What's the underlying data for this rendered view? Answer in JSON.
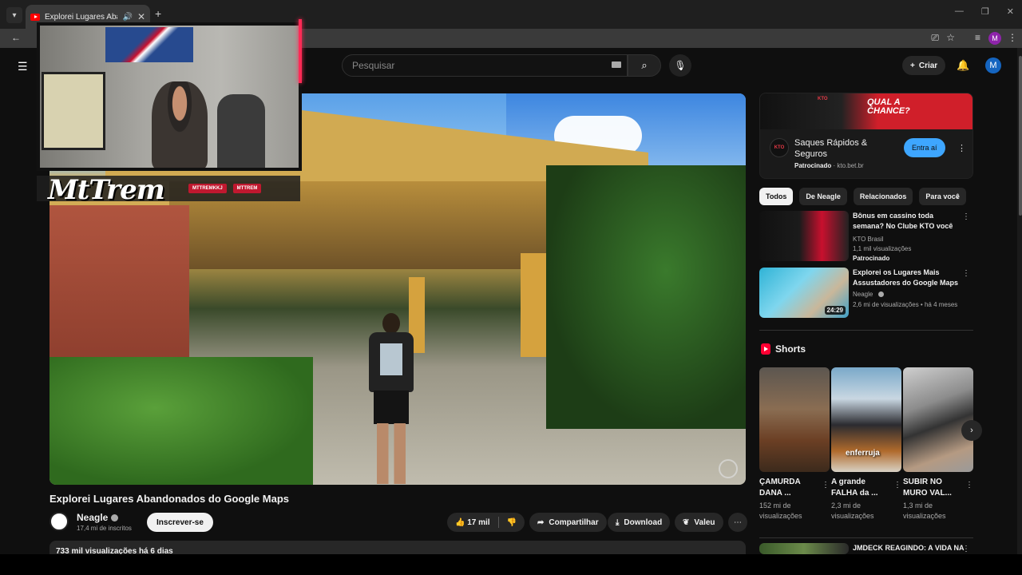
{
  "browser": {
    "tab_title": "Explorei Lugares Abandonados do Google Maps",
    "profile_initial": "M",
    "icons": {
      "tab_menu": "chevron-down-icon",
      "audio": "speaker-icon",
      "close": "close-icon",
      "new_tab": "plus-icon"
    }
  },
  "webcam": {
    "brand_logo": "MtTrem",
    "socials": [
      "MTTREMKKJ",
      "MTTREM"
    ]
  },
  "masthead": {
    "search_placeholder": "Pesquisar",
    "create_label": "Criar",
    "avatar_initial": "M"
  },
  "video": {
    "title": "Explorei Lugares Abandonados do Google Maps",
    "channel": {
      "name": "Neagle",
      "subscribers": "17,4 mi de inscritos",
      "subscribe_label": "Inscrever-se"
    },
    "actions": {
      "likes": "17 mil",
      "share": "Compartilhar",
      "download": "Download",
      "thanks": "Valeu"
    },
    "description_stats": "733 mil visualizações  há 6 dias"
  },
  "sidebar": {
    "ad": {
      "banner_brand": "KTO",
      "banner_text": "QUAL A CHANCE?",
      "logo_text": "KTO",
      "title": "Saques Rápidos & Seguros",
      "sponsored": "Patrocinado",
      "domain": "kto.bet.br",
      "cta": "Entra aí"
    },
    "chips": [
      "Todos",
      "De Neagle",
      "Relacionados",
      "Para você"
    ],
    "recommendations": [
      {
        "title": "Bônus em cassino toda semana? No Clube KTO você s...",
        "channel": "KTO Brasil",
        "views": "1,1 mil visualizações",
        "badge": "Patrocinado",
        "duration": ""
      },
      {
        "title": "Explorei os Lugares Mais Assustadores do Google Maps",
        "channel": "Neagle",
        "views": "2,6 mi de visualizações • há 4 meses",
        "badge": "",
        "duration": "24:29"
      }
    ],
    "shorts_heading": "Shorts",
    "shorts": [
      {
        "title": "ÇAMURDA DANA ...",
        "views": "152 mi de visualizações",
        "overlay": ""
      },
      {
        "title": "A grande FALHA da ...",
        "views": "2,3 mi de visualizações",
        "overlay": "enferruja"
      },
      {
        "title": "SUBIR NO MURO VAL...",
        "views": "1,3 mi de visualizações",
        "overlay": ""
      }
    ],
    "next_title": "JMDECK REAGINDO: A VIDA NA"
  },
  "colors": {
    "background": "#0f0f0f",
    "accent": "#3ea6ff",
    "brand_red": "#ff0000",
    "ad_red": "#d01f2a"
  }
}
